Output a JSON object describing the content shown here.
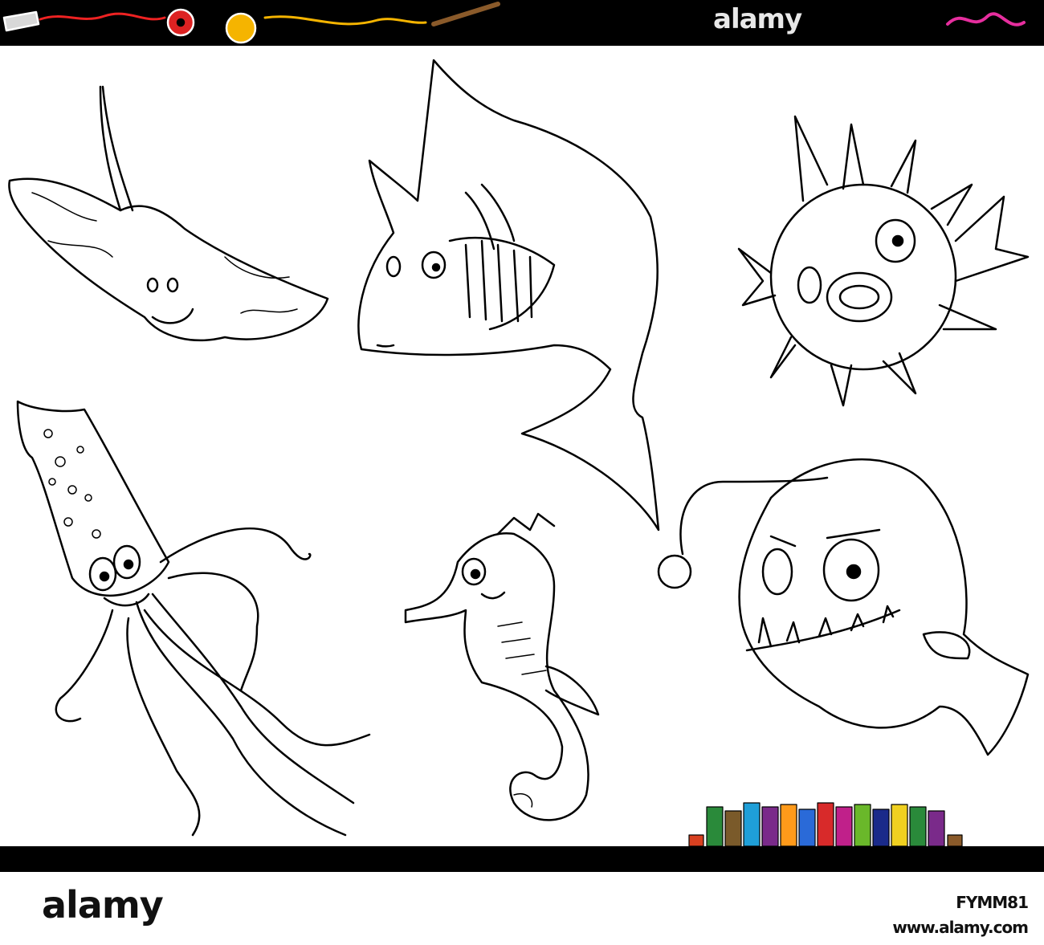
{
  "watermark": {
    "top": "alamy",
    "logo": "alamy"
  },
  "stock": {
    "image_id": "FYMM81",
    "site": "www.alamy.com"
  },
  "colors": {
    "border": "#000000",
    "background": "#ffffff",
    "signature": "#e62e9e",
    "pencils": [
      "#2a8a3a",
      "#7a5a2a",
      "#1f9fd8",
      "#7a2a8a",
      "#ff9a1a",
      "#2a6ad8",
      "#d82a2a",
      "#c0208a",
      "#6ab82a",
      "#1a2a8a",
      "#f0d020"
    ]
  },
  "illustrations": [
    "stingray",
    "shark",
    "pufferfish",
    "squid",
    "seahorse",
    "anglerfish",
    "colored-pencils",
    "header-doodles"
  ]
}
